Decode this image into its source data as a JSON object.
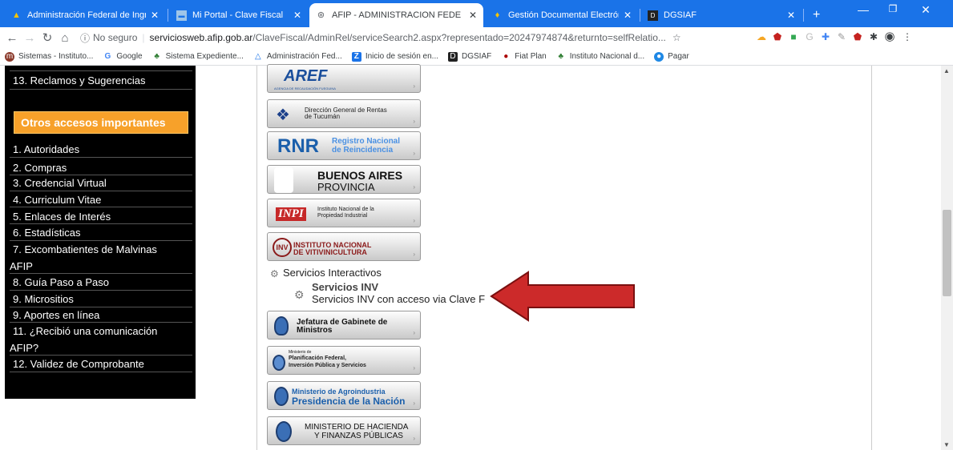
{
  "tabs": [
    {
      "title": "Administración Federal de Ingr",
      "favicon": "afip-icon"
    },
    {
      "title": "Mi Portal - Clave Fiscal",
      "favicon": "portal-icon"
    },
    {
      "title": "AFIP - ADMINISTRACION FEDE",
      "favicon": "globe-icon"
    },
    {
      "title": "Gestión Documental Electrónic",
      "favicon": "gde-icon"
    },
    {
      "title": "DGSIAF",
      "favicon": "dgsiaf-icon"
    }
  ],
  "new_tab": "+",
  "address": {
    "security": "No seguro",
    "host": "serviciosweb.afip.gob.ar",
    "path": "/ClaveFiscal/AdminRel/serviceSearch2.aspx?representado=20247974874&returnto=selfRelatio..."
  },
  "bookmarks": [
    "Sistemas - Instituto...",
    "Google",
    "Sistema Expediente...",
    "Administración Fed...",
    "Inicio de sesión en...",
    "DGSIAF",
    "Fiat Plan",
    "Instituto Nacional d...",
    "Pagar"
  ],
  "sidebar": {
    "top_item": "13. Reclamos y Sugerencias",
    "heading": "Otros accesos importantes",
    "items": [
      "1. Autoridades",
      "2. Compras",
      "3. Credencial Virtual",
      "4. Curriculum Vitae",
      "5. Enlaces de Interés",
      "6. Estadísticas",
      "7. Excombatientes de Malvinas",
      "AFIP",
      "8. Guía Paso a Paso",
      "9. Micrositios",
      "9. Aportes en línea",
      "11. ¿Recibió una comunicación",
      "AFIP?",
      "12. Validez de Comprobante"
    ]
  },
  "banners": {
    "aref": "AREF",
    "aref_sub": "AGENCIA DE RECAUDACIÓN FUEGUINA",
    "tucuman": [
      "Dirección General de Rentas",
      "de Tucumán"
    ],
    "rnr_big": "RNR",
    "rnr_small": [
      "Registro Nacional",
      "de Reincidencia"
    ],
    "ba": [
      "BUENOS AIRES",
      "PROVINCIA"
    ],
    "inpi": "INPI",
    "inpi_small": [
      "Instituto Nacional de la",
      "Propiedad Industrial"
    ],
    "inv": "INV",
    "inv_small": [
      "INSTITUTO NACIONAL",
      "DE VITIVINICULTURA"
    ],
    "jefatura": [
      "Jefatura de Gabinete de",
      "Ministros"
    ],
    "planif": [
      "Ministerio de",
      "Planificación Federal,",
      "Inversión Pública y Servicios"
    ],
    "agro": [
      "Ministerio de Agroindustria",
      "Presidencia de la Nación"
    ],
    "hacienda": [
      "MINISTERIO DE HACIENDA",
      "Y FINANZAS PÚBLICAS"
    ]
  },
  "services": {
    "heading": "Servicios Interactivos",
    "name": "Servicios INV",
    "desc": "Servicios INV con acceso via Clave F"
  }
}
